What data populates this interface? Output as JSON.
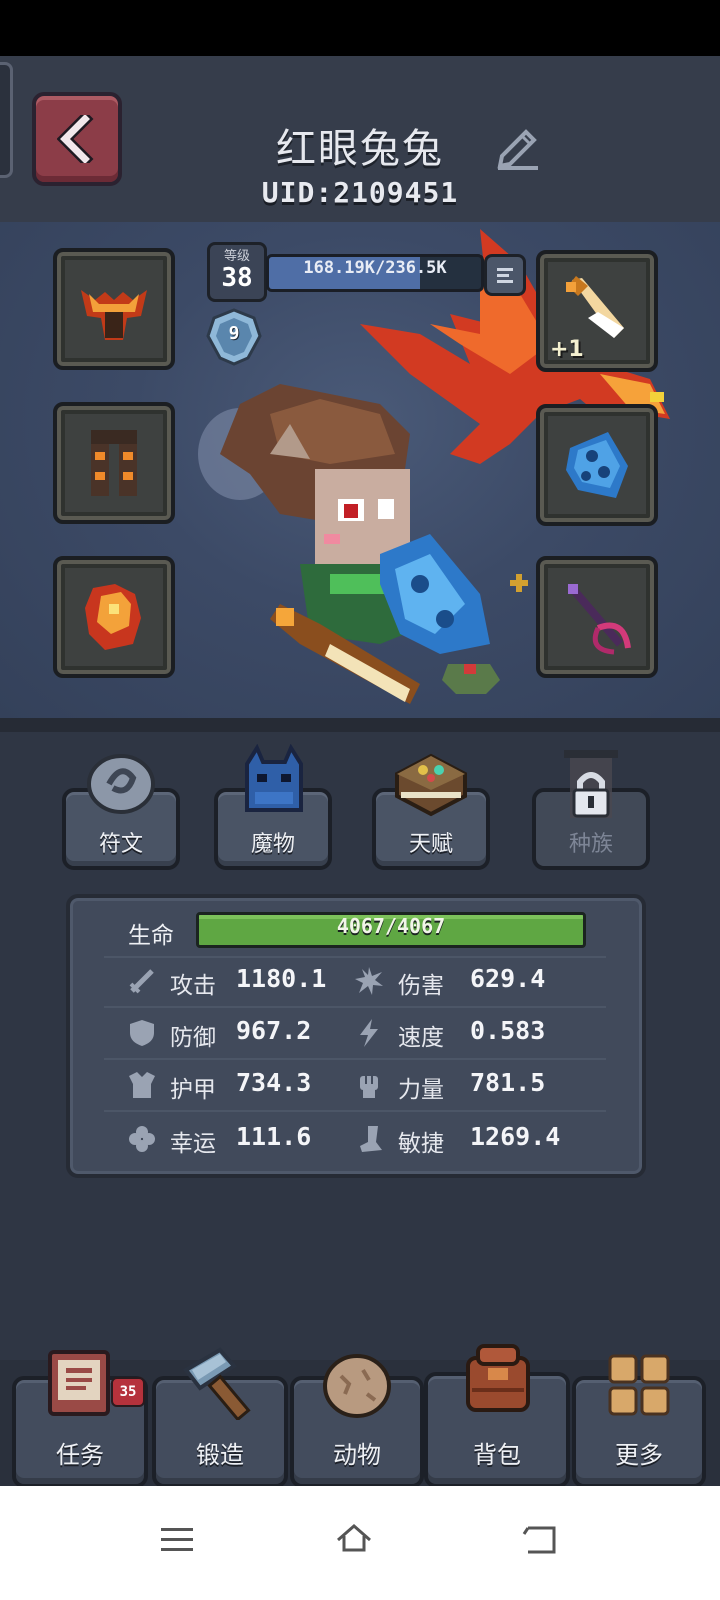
{
  "player": {
    "name": "红眼兔兔",
    "uid": "UID:2109451"
  },
  "level": {
    "label": "等级",
    "value": "38",
    "xp_text": "168.19K/236.5K",
    "xp_fraction": 0.711,
    "rank": "9"
  },
  "equipment": {
    "weapon_enhance": "+1"
  },
  "menus": [
    {
      "label": "符文",
      "locked": false
    },
    {
      "label": "魔物",
      "locked": false
    },
    {
      "label": "天赋",
      "locked": false
    },
    {
      "label": "种族",
      "locked": true
    }
  ],
  "stats": {
    "hp": {
      "label": "生命",
      "value": "4067/4067",
      "fraction": 1.0
    },
    "rows": [
      {
        "left": {
          "icon": "sword-icon",
          "label": "攻击",
          "value": "1180.1"
        },
        "right": {
          "icon": "burst-icon",
          "label": "伤害",
          "value": "629.4"
        }
      },
      {
        "left": {
          "icon": "shield-icon",
          "label": "防御",
          "value": "967.2"
        },
        "right": {
          "icon": "lightning-icon",
          "label": "速度",
          "value": "0.583"
        }
      },
      {
        "left": {
          "icon": "armor-icon",
          "label": "护甲",
          "value": "734.3"
        },
        "right": {
          "icon": "fist-icon",
          "label": "力量",
          "value": "781.5"
        }
      },
      {
        "left": {
          "icon": "clover-icon",
          "label": "幸运",
          "value": "111.6"
        },
        "right": {
          "icon": "boot-icon",
          "label": "敏捷",
          "value": "1269.4"
        }
      }
    ]
  },
  "nav": [
    {
      "label": "任务",
      "icon": "quest-book-icon",
      "badge": "35"
    },
    {
      "label": "锻造",
      "icon": "hammer-icon"
    },
    {
      "label": "动物",
      "icon": "egg-icon"
    },
    {
      "label": "背包",
      "icon": "backpack-icon"
    },
    {
      "label": "更多",
      "icon": "grid-icon"
    }
  ],
  "colors": {
    "hp_green": "#5fa743",
    "xp_blue": "#4f6ea6",
    "back_button": "#8c3d48",
    "badge_red": "#b5323c"
  }
}
